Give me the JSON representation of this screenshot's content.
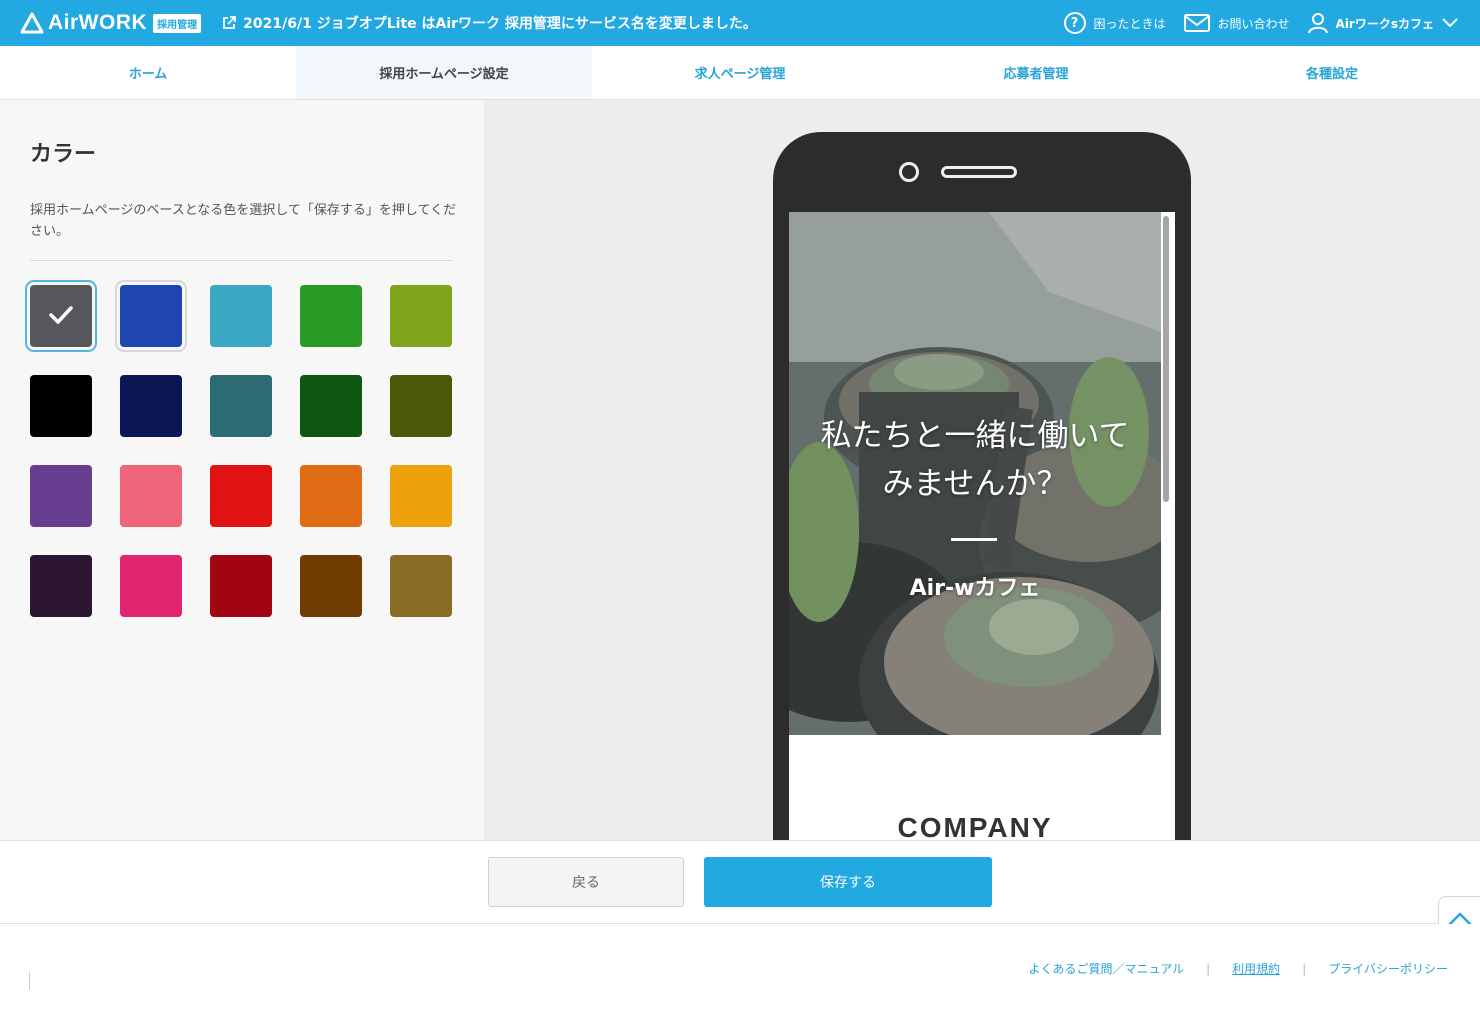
{
  "header": {
    "logo_text": "AirWORK",
    "logo_badge": "採用管理",
    "notice": "2021/6/1 ジョブオプLite はAirワーク 採用管理にサービス名を変更しました。",
    "help_label": "困ったときは",
    "contact_label": "お問い合わせ",
    "account_label": "Airワークsカフェ"
  },
  "nav": {
    "items": [
      {
        "label": "ホーム"
      },
      {
        "label": "採用ホームページ設定"
      },
      {
        "label": "求人ページ管理"
      },
      {
        "label": "応募者管理"
      },
      {
        "label": "各種設定"
      }
    ],
    "active_index": 1
  },
  "panel": {
    "title": "カラー",
    "description": "採用ホームページのベースとなる色を選択して「保存する」を押してください。",
    "selected_color": "#55575a",
    "colors": [
      "#55575a",
      "#1f46b0",
      "#3aa8c2",
      "#2a9a27",
      "#7fa31a",
      "#000000",
      "#0b1655",
      "#2b6b73",
      "#0f5610",
      "#4a5808",
      "#673d8f",
      "#ee6478",
      "#e11212",
      "#e06c16",
      "#eda10d",
      "#2d1634",
      "#e0246f",
      "#a10412",
      "#703c00",
      "#886c23"
    ]
  },
  "preview": {
    "hero_title_line1": "私たちと一緒に働いて",
    "hero_title_line2": "みませんか？",
    "company_name": "Air-wカフェ",
    "section_heading": "COMPANY"
  },
  "actions": {
    "back_label": "戻る",
    "save_label": "保存する"
  },
  "footer": {
    "links": [
      {
        "label": "よくあるご質問／マニュアル"
      },
      {
        "label": "利用規約"
      },
      {
        "label": "プライバシーポリシー"
      }
    ]
  },
  "icons": {
    "logo": "triangle-logo-icon",
    "notice": "external-link-icon",
    "help": "question-circle-icon",
    "contact": "mail-icon",
    "account": "user-icon",
    "dropdown": "chevron-down-icon",
    "scroll_top": "chevron-up-icon",
    "check": "check-icon"
  }
}
